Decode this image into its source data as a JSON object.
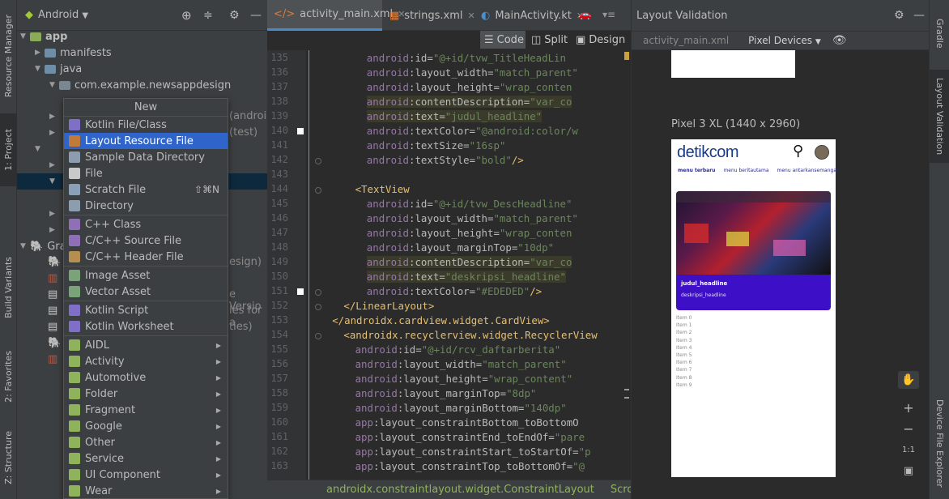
{
  "left_strip": {
    "resource_manager": "Resource Manager",
    "project": "1: Project",
    "build_variants": "Build Variants",
    "favorites": "2: Favorites",
    "structure": "Z: Structure"
  },
  "project_panel": {
    "view_selector": "Android",
    "tree": [
      {
        "label": "app",
        "expanded": true
      },
      {
        "label": "manifests",
        "expanded": false
      },
      {
        "label": "java",
        "expanded": true
      },
      {
        "label": "com.example.newsappdesign",
        "expanded": true
      }
    ],
    "partial_behind_menu": [
      {
        "label": "(androic"
      },
      {
        "label": "(test)"
      },
      {
        "label": "Gra"
      },
      {
        "label": "esign)"
      },
      {
        "label": "e Versio"
      },
      {
        "label": "les for a"
      },
      {
        "label": "ties)"
      }
    ]
  },
  "context_menu": {
    "title": "New",
    "items": [
      {
        "label": "Kotlin File/Class",
        "icon": "kotlin-file-icon",
        "color": "#7f6fc7"
      },
      {
        "label": "Layout Resource File",
        "icon": "layout-file-icon",
        "color": "#c07a3a",
        "selected": true
      },
      {
        "label": "Sample Data Directory",
        "icon": "folder-icon",
        "color": "#8b9dae"
      },
      {
        "label": "File",
        "icon": "file-icon",
        "color": "#c9c9c9"
      },
      {
        "label": "Scratch File",
        "icon": "scratch-file-icon",
        "color": "#8aa0b8",
        "shortcut": "⇧⌘N"
      },
      {
        "label": "Directory",
        "icon": "folder-icon",
        "color": "#8b9dae"
      },
      {
        "label": "C++ Class",
        "icon": "cpp-class-icon",
        "color": "#8f6fb5"
      },
      {
        "label": "C/C++ Source File",
        "icon": "cpp-source-icon",
        "color": "#8f6fb5"
      },
      {
        "label": "C/C++ Header File",
        "icon": "cpp-header-icon",
        "color": "#b58f4f"
      },
      {
        "label": "Image Asset",
        "icon": "image-asset-icon",
        "color": "#7aa37a"
      },
      {
        "label": "Vector Asset",
        "icon": "vector-asset-icon",
        "color": "#7aa37a"
      },
      {
        "label": "Kotlin Script",
        "icon": "kotlin-script-icon",
        "color": "#7f6fc7"
      },
      {
        "label": "Kotlin Worksheet",
        "icon": "kotlin-worksheet-icon",
        "color": "#7f6fc7"
      },
      {
        "label": "AIDL",
        "icon": "android-icon",
        "color": "#8fb35a",
        "submenu": true
      },
      {
        "label": "Activity",
        "icon": "android-icon",
        "color": "#8fb35a",
        "submenu": true
      },
      {
        "label": "Automotive",
        "icon": "android-icon",
        "color": "#8fb35a",
        "submenu": true
      },
      {
        "label": "Folder",
        "icon": "android-icon",
        "color": "#8fb35a",
        "submenu": true
      },
      {
        "label": "Fragment",
        "icon": "android-icon",
        "color": "#8fb35a",
        "submenu": true
      },
      {
        "label": "Google",
        "icon": "android-icon",
        "color": "#8fb35a",
        "submenu": true
      },
      {
        "label": "Other",
        "icon": "android-icon",
        "color": "#8fb35a",
        "submenu": true
      },
      {
        "label": "Service",
        "icon": "android-icon",
        "color": "#8fb35a",
        "submenu": true
      },
      {
        "label": "UI Component",
        "icon": "android-icon",
        "color": "#8fb35a",
        "submenu": true
      },
      {
        "label": "Wear",
        "icon": "android-icon",
        "color": "#8fb35a",
        "submenu": true
      }
    ]
  },
  "tabs": [
    {
      "label": "activity_main.xml",
      "active": true
    },
    {
      "label": "strings.xml"
    },
    {
      "label": "MainActivity.kt"
    }
  ],
  "view_modes": {
    "code": "Code",
    "split": "Split",
    "design": "Design"
  },
  "editor": {
    "lines": [
      {
        "n": "135",
        "indent": 8,
        "tokens": [
          [
            "ns",
            "android"
          ],
          [
            "attr",
            ":id="
          ],
          [
            "str",
            "\"@+id/tvw_TitleHeadLin"
          ]
        ]
      },
      {
        "n": "136",
        "indent": 8,
        "tokens": [
          [
            "ns",
            "android"
          ],
          [
            "attr",
            ":layout_width="
          ],
          [
            "str",
            "\"match_parent\""
          ]
        ]
      },
      {
        "n": "137",
        "indent": 8,
        "tokens": [
          [
            "ns",
            "android"
          ],
          [
            "attr",
            ":layout_height="
          ],
          [
            "str",
            "\"wrap_conten"
          ]
        ]
      },
      {
        "n": "138",
        "indent": 8,
        "hl": true,
        "tokens": [
          [
            "ns",
            "android"
          ],
          [
            "attr",
            ":contentDescription="
          ],
          [
            "str",
            "\"var_co"
          ]
        ]
      },
      {
        "n": "139",
        "indent": 8,
        "hl": true,
        "tokens": [
          [
            "ns",
            "android"
          ],
          [
            "attr",
            ":text="
          ],
          [
            "str",
            "\"judul_headline\""
          ]
        ]
      },
      {
        "n": "140",
        "indent": 8,
        "tokens": [
          [
            "ns",
            "android"
          ],
          [
            "attr",
            ":textColor="
          ],
          [
            "str",
            "\"@android:color/w"
          ]
        ]
      },
      {
        "n": "141",
        "indent": 8,
        "tokens": [
          [
            "ns",
            "android"
          ],
          [
            "attr",
            ":textSize="
          ],
          [
            "str",
            "\"16sp\""
          ]
        ]
      },
      {
        "n": "142",
        "indent": 8,
        "tokens": [
          [
            "ns",
            "android"
          ],
          [
            "attr",
            ":textStyle="
          ],
          [
            "str",
            "\"bold\""
          ],
          [
            "tagc",
            "/>"
          ]
        ]
      },
      {
        "n": "143",
        "indent": 0,
        "tokens": []
      },
      {
        "n": "144",
        "indent": 6,
        "tokens": [
          [
            "tagc",
            "<TextView"
          ]
        ]
      },
      {
        "n": "145",
        "indent": 8,
        "tokens": [
          [
            "ns",
            "android"
          ],
          [
            "attr",
            ":id="
          ],
          [
            "str",
            "\"@+id/tvw_DescHeadline\""
          ]
        ]
      },
      {
        "n": "146",
        "indent": 8,
        "tokens": [
          [
            "ns",
            "android"
          ],
          [
            "attr",
            ":layout_width="
          ],
          [
            "str",
            "\"match_parent\""
          ]
        ]
      },
      {
        "n": "147",
        "indent": 8,
        "tokens": [
          [
            "ns",
            "android"
          ],
          [
            "attr",
            ":layout_height="
          ],
          [
            "str",
            "\"wrap_conten"
          ]
        ]
      },
      {
        "n": "148",
        "indent": 8,
        "tokens": [
          [
            "ns",
            "android"
          ],
          [
            "attr",
            ":layout_marginTop="
          ],
          [
            "str",
            "\"10dp\""
          ]
        ]
      },
      {
        "n": "149",
        "indent": 8,
        "hl": true,
        "tokens": [
          [
            "ns",
            "android"
          ],
          [
            "attr",
            ":contentDescription="
          ],
          [
            "str",
            "\"var_co"
          ]
        ]
      },
      {
        "n": "150",
        "indent": 8,
        "hl": true,
        "tokens": [
          [
            "ns",
            "android"
          ],
          [
            "attr",
            ":text="
          ],
          [
            "str",
            "\"deskripsi_headline\""
          ]
        ]
      },
      {
        "n": "151",
        "indent": 8,
        "tokens": [
          [
            "ns",
            "android"
          ],
          [
            "attr",
            ":textColor="
          ],
          [
            "str",
            "\"#EDEDED\""
          ],
          [
            "tagc",
            "/>"
          ]
        ]
      },
      {
        "n": "152",
        "indent": 4,
        "tokens": [
          [
            "tagc",
            "</LinearLayout>"
          ]
        ]
      },
      {
        "n": "153",
        "indent": 2,
        "tokens": [
          [
            "tagc",
            "</androidx.cardview.widget.CardView>"
          ]
        ]
      },
      {
        "n": "154",
        "indent": 4,
        "tokens": [
          [
            "tagc",
            "<androidx.recyclerview.widget.RecyclerView"
          ]
        ]
      },
      {
        "n": "155",
        "indent": 6,
        "tokens": [
          [
            "ns",
            "android"
          ],
          [
            "attr",
            ":id="
          ],
          [
            "str",
            "\"@+id/rcv_daftarberita\""
          ]
        ]
      },
      {
        "n": "156",
        "indent": 6,
        "tokens": [
          [
            "ns",
            "android"
          ],
          [
            "attr",
            ":layout_width="
          ],
          [
            "str",
            "\"match_parent\""
          ]
        ]
      },
      {
        "n": "157",
        "indent": 6,
        "tokens": [
          [
            "ns",
            "android"
          ],
          [
            "attr",
            ":layout_height="
          ],
          [
            "str",
            "\"wrap_content\""
          ]
        ]
      },
      {
        "n": "158",
        "indent": 6,
        "tokens": [
          [
            "ns",
            "android"
          ],
          [
            "attr",
            ":layout_marginTop="
          ],
          [
            "str",
            "\"8dp\""
          ]
        ]
      },
      {
        "n": "159",
        "indent": 6,
        "tokens": [
          [
            "ns",
            "android"
          ],
          [
            "attr",
            ":layout_marginBottom="
          ],
          [
            "str",
            "\"140dp\""
          ]
        ]
      },
      {
        "n": "160",
        "indent": 6,
        "tokens": [
          [
            "ns",
            "app"
          ],
          [
            "attr",
            ":layout_constraintBottom_toBottomO"
          ]
        ]
      },
      {
        "n": "161",
        "indent": 6,
        "tokens": [
          [
            "ns",
            "app"
          ],
          [
            "attr",
            ":layout_constraintEnd_toEndOf="
          ],
          [
            "str",
            "\"pare"
          ]
        ]
      },
      {
        "n": "162",
        "indent": 6,
        "tokens": [
          [
            "ns",
            "app"
          ],
          [
            "attr",
            ":layout_constraintStart_toStartOf="
          ],
          [
            "str",
            "\"p"
          ]
        ]
      },
      {
        "n": "163",
        "indent": 6,
        "tokens": [
          [
            "ns",
            "app"
          ],
          [
            "attr",
            ":layout_constraintTop_toBottomOf="
          ],
          [
            "str",
            "\"@"
          ]
        ]
      }
    ],
    "breadcrumbs": [
      "androidx.constraintlayout.widget.ConstraintLayout",
      "ScrollView"
    ]
  },
  "layout_validation": {
    "title": "Layout Validation",
    "file": "activity_main.xml",
    "device_selector": "Pixel Devices",
    "device_label": "Pixel 3 XL (1440 x 2960)"
  },
  "phone": {
    "brand": "detikcom",
    "menu": [
      "menu terbaru",
      "menu beritautama",
      "menu antarkansemangat"
    ],
    "headline_title": "judul_headline",
    "headline_desc": "deskripsi_headline",
    "items": [
      "Item 0",
      "Item 1",
      "Item 2",
      "Item 3",
      "Item 4",
      "Item 5",
      "Item 6",
      "Item 7",
      "Item 8",
      "Item 9"
    ],
    "accent": "#3d0fc7"
  },
  "right_strip": {
    "gradle": "Gradle",
    "layout_validation": "Layout Validation",
    "device_file_explorer": "Device File Explorer"
  },
  "zoom": {
    "pan": "✋",
    "in": "+",
    "out": "−",
    "fit": "1:1",
    "screen": "▣"
  }
}
